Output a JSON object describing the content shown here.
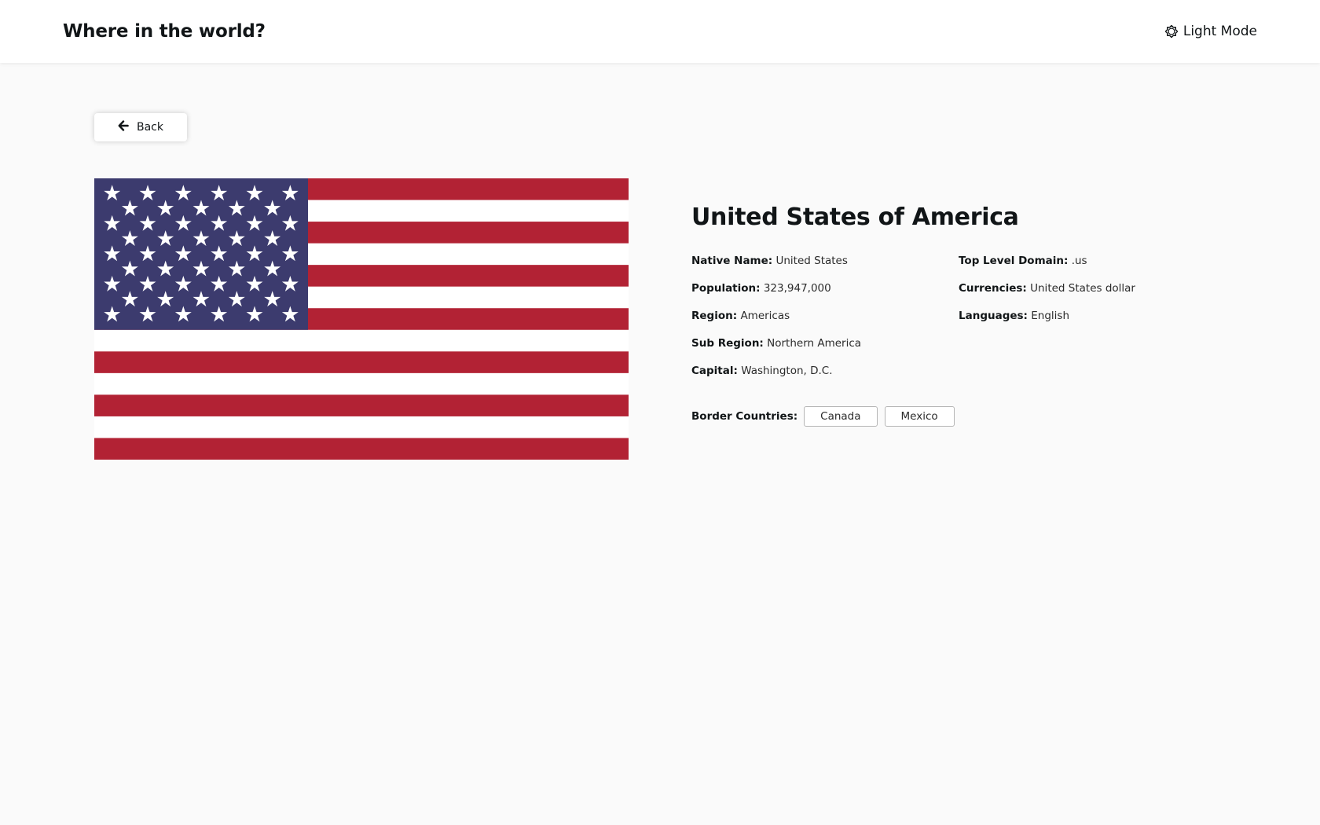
{
  "header": {
    "title": "Where in the world?",
    "theme_toggle_label": "Light Mode",
    "theme_icon": "sun-icon"
  },
  "back_button": {
    "label": "Back",
    "icon": "arrow-left-icon"
  },
  "flag": {
    "icon": "us-flag-image",
    "colors": {
      "red": "#b22234",
      "white": "#ffffff",
      "blue": "#3c3b6e"
    }
  },
  "country": {
    "name": "United States of America",
    "info_left": [
      {
        "label": "Native Name:",
        "value": "United States"
      },
      {
        "label": "Population:",
        "value": "323,947,000"
      },
      {
        "label": "Region:",
        "value": "Americas"
      },
      {
        "label": "Sub Region:",
        "value": "Northern America"
      },
      {
        "label": "Capital:",
        "value": "Washington, D.C."
      }
    ],
    "info_right": [
      {
        "label": "Top Level Domain:",
        "value": ".us"
      },
      {
        "label": "Currencies:",
        "value": "United States dollar"
      },
      {
        "label": "Languages:",
        "value": "English"
      }
    ],
    "border_countries_label": "Border Countries:",
    "border_countries": [
      "Canada",
      "Mexico"
    ]
  }
}
